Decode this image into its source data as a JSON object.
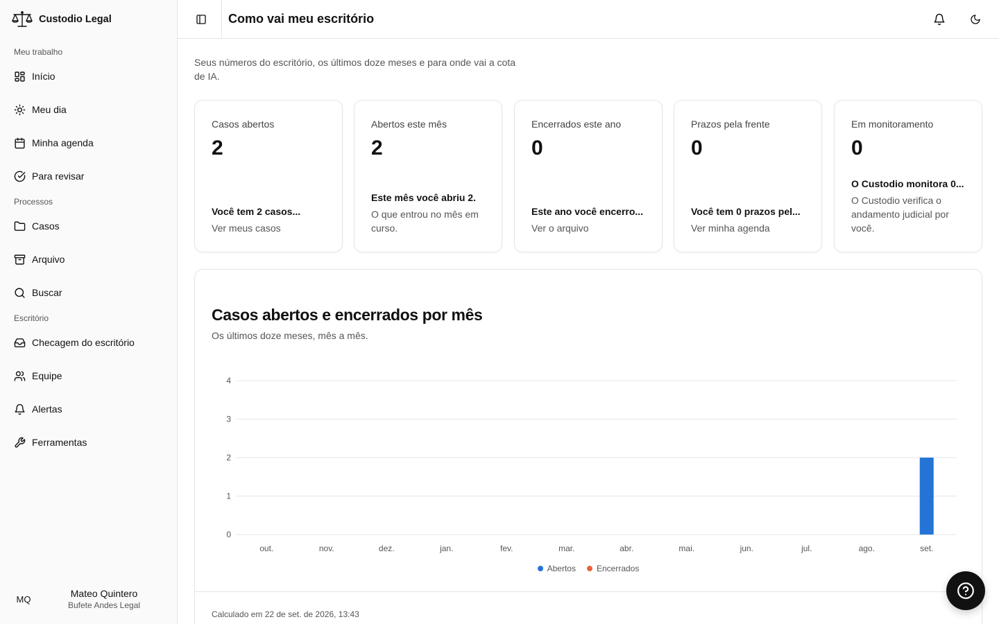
{
  "app": {
    "name": "Custodio Legal"
  },
  "sidebar": {
    "sections": [
      {
        "label": "Meu trabalho"
      },
      {
        "label": "Processos"
      },
      {
        "label": "Escritório"
      }
    ],
    "items": [
      {
        "label": "Início",
        "icon": "layout-grid-icon"
      },
      {
        "label": "Meu dia",
        "icon": "sun-icon"
      },
      {
        "label": "Minha agenda",
        "icon": "calendar-icon"
      },
      {
        "label": "Para revisar",
        "icon": "check-circle-icon"
      },
      {
        "label": "Casos",
        "icon": "folder-icon"
      },
      {
        "label": "Arquivo",
        "icon": "archive-icon"
      },
      {
        "label": "Buscar",
        "icon": "search-icon"
      },
      {
        "label": "Checagem do escritório",
        "icon": "inbox-icon"
      },
      {
        "label": "Equipe",
        "icon": "users-icon"
      },
      {
        "label": "Alertas",
        "icon": "bell-icon"
      },
      {
        "label": "Ferramentas",
        "icon": "wrench-icon"
      }
    ],
    "user": {
      "initials": "MQ",
      "name": "Mateo Quintero",
      "org": "Bufete Andes Legal"
    }
  },
  "header": {
    "title": "Como vai meu escritório"
  },
  "intro": "Seus números do escritório, os últimos doze meses e para onde vai a cota de IA.",
  "cards": [
    {
      "label": "Casos abertos",
      "value": "2",
      "foot_title": "Você tem 2 casos...",
      "foot_desc": "Ver meus casos"
    },
    {
      "label": "Abertos este mês",
      "value": "2",
      "foot_title": "Este mês você abriu 2.",
      "foot_desc": "O que entrou no mês em curso."
    },
    {
      "label": "Encerrados este ano",
      "value": "0",
      "foot_title": "Este ano você encerro...",
      "foot_desc": "Ver o arquivo"
    },
    {
      "label": "Prazos pela frente",
      "value": "0",
      "foot_title": "Você tem 0 prazos pel...",
      "foot_desc": "Ver minha agenda"
    },
    {
      "label": "Em monitoramento",
      "value": "0",
      "foot_title": "O Custodio monitora 0...",
      "foot_desc": "O Custodio verifica o andamento judicial por você."
    }
  ],
  "chart_section": {
    "title": "Casos abertos e encerrados por mês",
    "subtitle": "Os últimos doze meses, mês a mês.",
    "footer": "Calculado em 22 de set. de 2026, 13:43"
  },
  "colors": {
    "abertos": "#2474d6",
    "encerrados": "#e8643a"
  },
  "chart_data": {
    "type": "bar",
    "categories": [
      "out.",
      "nov.",
      "dez.",
      "jan.",
      "fev.",
      "mar.",
      "abr.",
      "mai.",
      "jun.",
      "jul.",
      "ago.",
      "set."
    ],
    "series": [
      {
        "name": "Abertos",
        "values": [
          0,
          0,
          0,
          0,
          0,
          0,
          0,
          0,
          0,
          0,
          0,
          2
        ]
      },
      {
        "name": "Encerrados",
        "values": [
          0,
          0,
          0,
          0,
          0,
          0,
          0,
          0,
          0,
          0,
          0,
          0
        ]
      }
    ],
    "yticks": [
      "0",
      "1",
      "2",
      "3",
      "4"
    ],
    "ylim": [
      0,
      4
    ],
    "grid": true,
    "legend": "bottom-center"
  }
}
